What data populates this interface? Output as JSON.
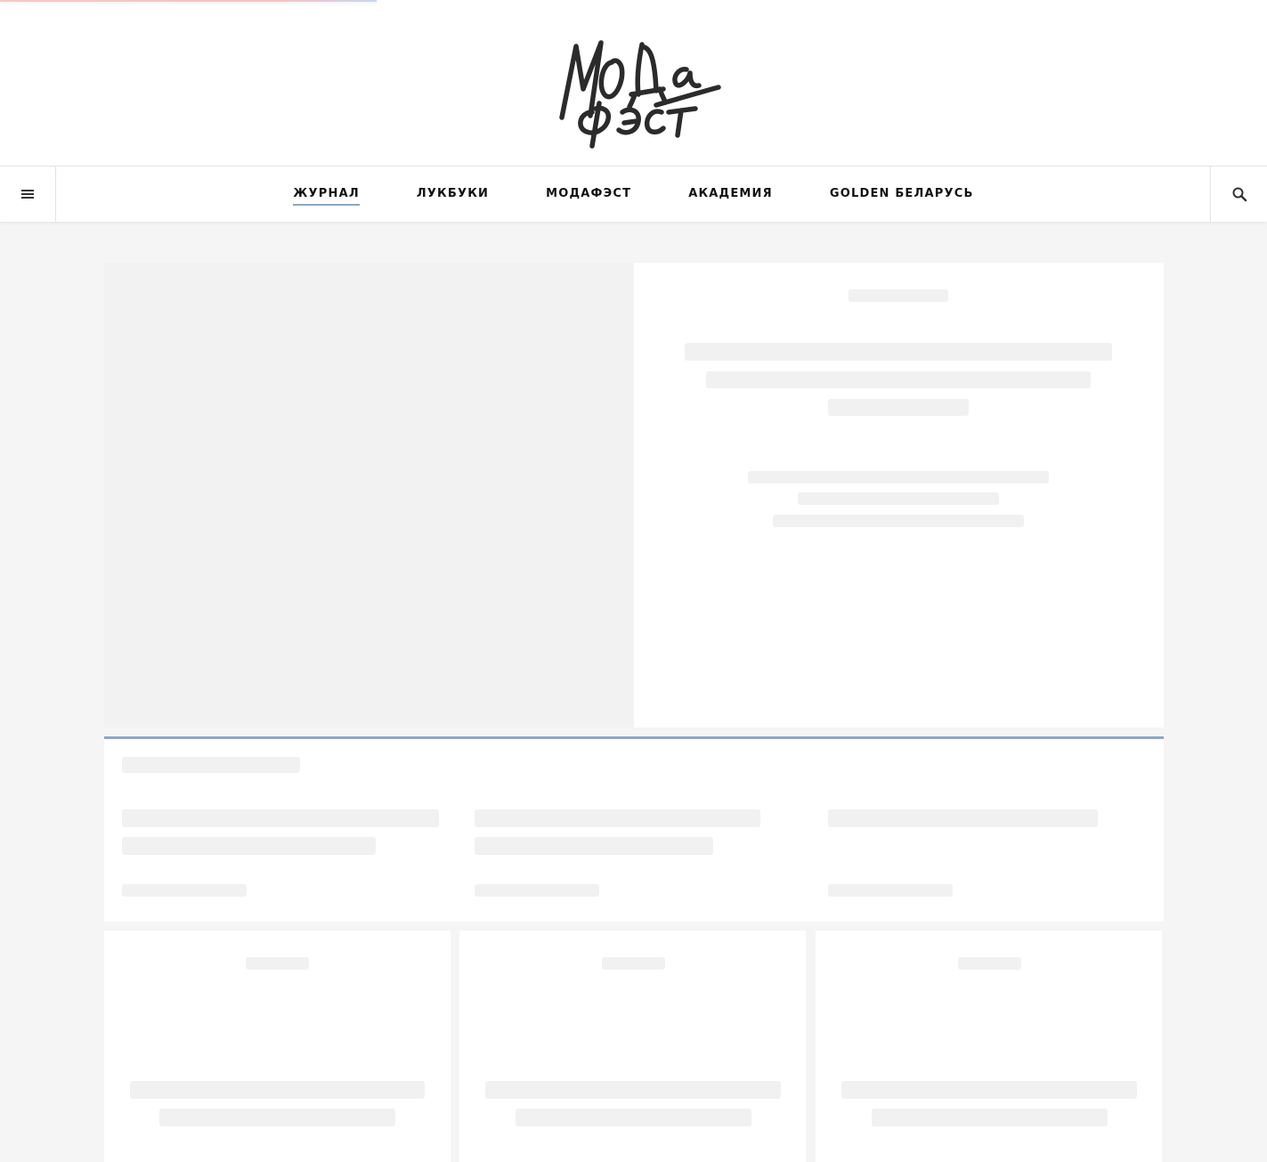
{
  "logo": {
    "alt": "Мода Фэст",
    "line1": "МОДа",
    "line2": "Фэст"
  },
  "header": {
    "menu_icon": "hamburger-menu-icon",
    "search_icon": "search-icon"
  },
  "nav": {
    "items": [
      {
        "label": "ЖУРНАЛ",
        "active": true
      },
      {
        "label": "ЛУКБУКИ",
        "active": false
      },
      {
        "label": "МОДАФЭСТ",
        "active": false
      },
      {
        "label": "АКАДЕМИЯ",
        "active": false
      },
      {
        "label": "GOLDEN БЕЛАРУСЬ",
        "active": false
      }
    ]
  },
  "colors": {
    "accent": "#8ea6c7",
    "page_background": "#f5f5f5",
    "skeleton": "#f1f1f1",
    "progress_bar": "#f0c4c6"
  },
  "state": {
    "content_loading": true
  }
}
